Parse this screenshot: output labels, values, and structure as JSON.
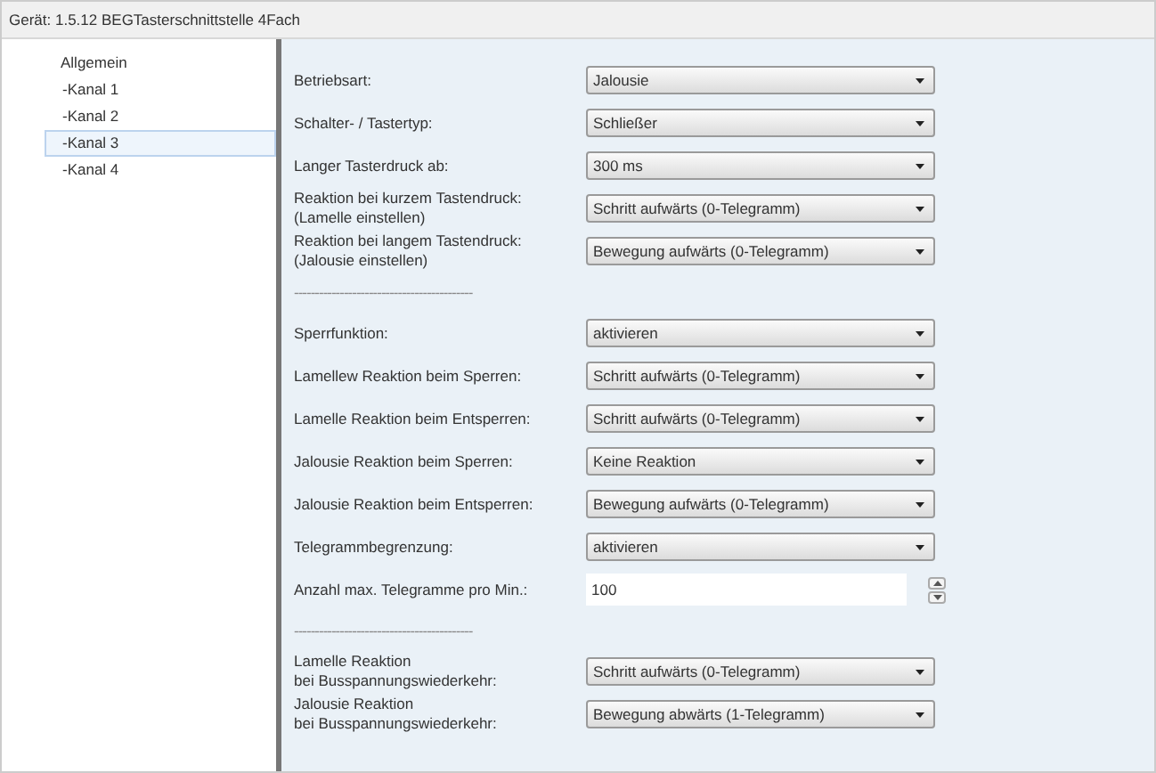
{
  "title": "Gerät: 1.5.12  BEGTasterschnittstelle 4Fach",
  "sidebar": {
    "items": [
      {
        "label": "Allgemein",
        "selected": false
      },
      {
        "label": "-Kanal 1",
        "selected": false
      },
      {
        "label": "-Kanal 2",
        "selected": false
      },
      {
        "label": "-Kanal 3",
        "selected": true
      },
      {
        "label": "-Kanal 4",
        "selected": false
      }
    ]
  },
  "parameters": [
    {
      "kind": "select",
      "label": "Betriebsart:",
      "value": "Jalousie"
    },
    {
      "kind": "select",
      "label": "Schalter- / Tastertyp:",
      "value": "Schließer"
    },
    {
      "kind": "select",
      "label": "Langer Tasterdruck ab:",
      "value": "300 ms"
    },
    {
      "kind": "select",
      "label": "Reaktion bei kurzem Tastendruck:\n(Lamelle einstellen)",
      "value": "Schritt aufwärts (0-Telegramm)"
    },
    {
      "kind": "select",
      "label": "Reaktion bei langem Tastendruck:\n(Jalousie einstellen)",
      "value": "Bewegung aufwärts (0-Telegramm)"
    },
    {
      "kind": "divider",
      "label": "-------------------------------------------"
    },
    {
      "kind": "select",
      "label": "Sperrfunktion:",
      "value": "aktivieren"
    },
    {
      "kind": "select",
      "label": "Lamellew Reaktion beim Sperren:",
      "value": "Schritt aufwärts (0-Telegramm)"
    },
    {
      "kind": "select",
      "label": "Lamelle Reaktion beim Entsperren:",
      "value": "Schritt aufwärts (0-Telegramm)"
    },
    {
      "kind": "select",
      "label": "Jalousie Reaktion beim Sperren:",
      "value": "Keine Reaktion"
    },
    {
      "kind": "select",
      "label": "Jalousie Reaktion beim Entsperren:",
      "value": "Bewegung aufwärts (0-Telegramm)"
    },
    {
      "kind": "select",
      "label": "Telegrammbegrenzung:",
      "value": "aktivieren"
    },
    {
      "kind": "spinner",
      "label": "Anzahl max. Telegramme pro Min.:",
      "value": "100"
    },
    {
      "kind": "divider",
      "label": "-------------------------------------------"
    },
    {
      "kind": "select",
      "label": "Lamelle Reaktion\nbei Busspannungswiederkehr:",
      "value": "Schritt aufwärts (0-Telegramm)"
    },
    {
      "kind": "select",
      "label": "Jalousie Reaktion\nbei Busspannungswiederkehr:",
      "value": "Bewegung abwärts (1-Telegramm)"
    }
  ]
}
